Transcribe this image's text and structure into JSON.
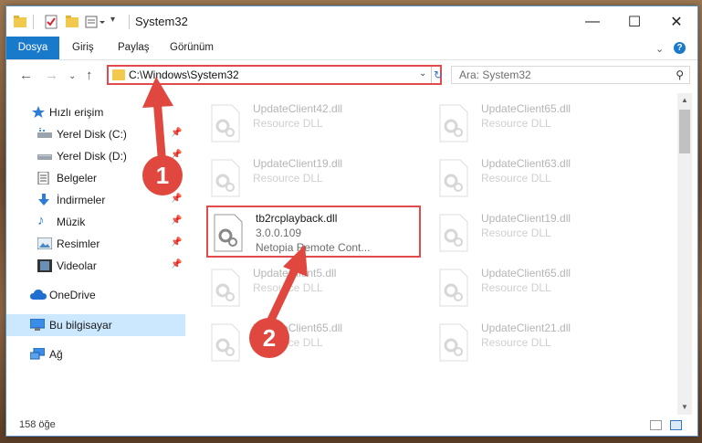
{
  "window": {
    "title": "System32",
    "controls": {
      "minimize": "—",
      "maximize": "☐",
      "close": "✕"
    }
  },
  "ribbon": {
    "tabs": [
      "Dosya",
      "Giriş",
      "Paylaş",
      "Görünüm"
    ],
    "help": "?"
  },
  "navigation": {
    "address": "C:\\Windows\\System32",
    "search_placeholder": "Ara: System32"
  },
  "sidebar": {
    "items": [
      {
        "label": "Hızlı erişim",
        "icon": "star-icon"
      },
      {
        "label": "Yerel Disk (C:)",
        "icon": "drive-icon",
        "pinned": true
      },
      {
        "label": "Yerel Disk (D:)",
        "icon": "drive-icon",
        "pinned": true
      },
      {
        "label": "Belgeler",
        "icon": "documents-icon",
        "pinned": true
      },
      {
        "label": "İndirmeler",
        "icon": "download-icon",
        "pinned": true
      },
      {
        "label": "Müzik",
        "icon": "music-icon",
        "pinned": true
      },
      {
        "label": "Resimler",
        "icon": "pictures-icon",
        "pinned": true
      },
      {
        "label": "Videolar",
        "icon": "video-icon",
        "pinned": true
      },
      {
        "label": "OneDrive",
        "icon": "cloud-icon"
      },
      {
        "label": "Bu bilgisayar",
        "icon": "computer-icon",
        "selected": true
      },
      {
        "label": "Ağ",
        "icon": "network-icon"
      }
    ]
  },
  "files": {
    "left": [
      {
        "name": "UpdateClient42.dll",
        "desc": "Resource DLL"
      },
      {
        "name": "UpdateClient19.dll",
        "desc": "Resource DLL"
      },
      {
        "name": "tb2rcplayback.dll",
        "version": "3.0.0.109",
        "desc": "Netopia Remote Cont..."
      },
      {
        "name": "UpdateClient5.dll",
        "desc": "Resource DLL"
      },
      {
        "name": "UpdateClient65.dll",
        "desc": "Resource DLL"
      }
    ],
    "right": [
      {
        "name": "UpdateClient65.dll",
        "desc": "Resource DLL"
      },
      {
        "name": "UpdateClient63.dll",
        "desc": "Resource DLL"
      },
      {
        "name": "UpdateClient19.dll",
        "desc": "Resource DLL"
      },
      {
        "name": "UpdateClient65.dll",
        "desc": "Resource DLL"
      },
      {
        "name": "UpdateClient21.dll",
        "desc": "Resource DLL"
      }
    ]
  },
  "status": {
    "item_count": "158 öğe"
  },
  "annotations": {
    "step1": "1",
    "step2": "2",
    "color": "#e0483f"
  }
}
